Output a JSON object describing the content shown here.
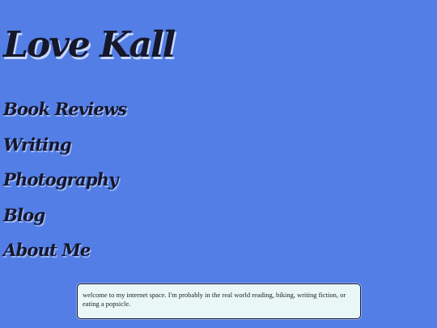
{
  "site": {
    "title": "Love Kall"
  },
  "nav": {
    "items": [
      {
        "label": "Book Reviews"
      },
      {
        "label": "Writing"
      },
      {
        "label": "Photography"
      },
      {
        "label": "Blog"
      },
      {
        "label": "About Me"
      }
    ]
  },
  "welcome": {
    "text": "welcome to my internet space. I'm probably in the real world reading, biking, writing fiction, or eating a popsicle."
  },
  "colors": {
    "background": "#537ee6",
    "title_text": "#15172a",
    "box_background": "#e9f7f7"
  }
}
